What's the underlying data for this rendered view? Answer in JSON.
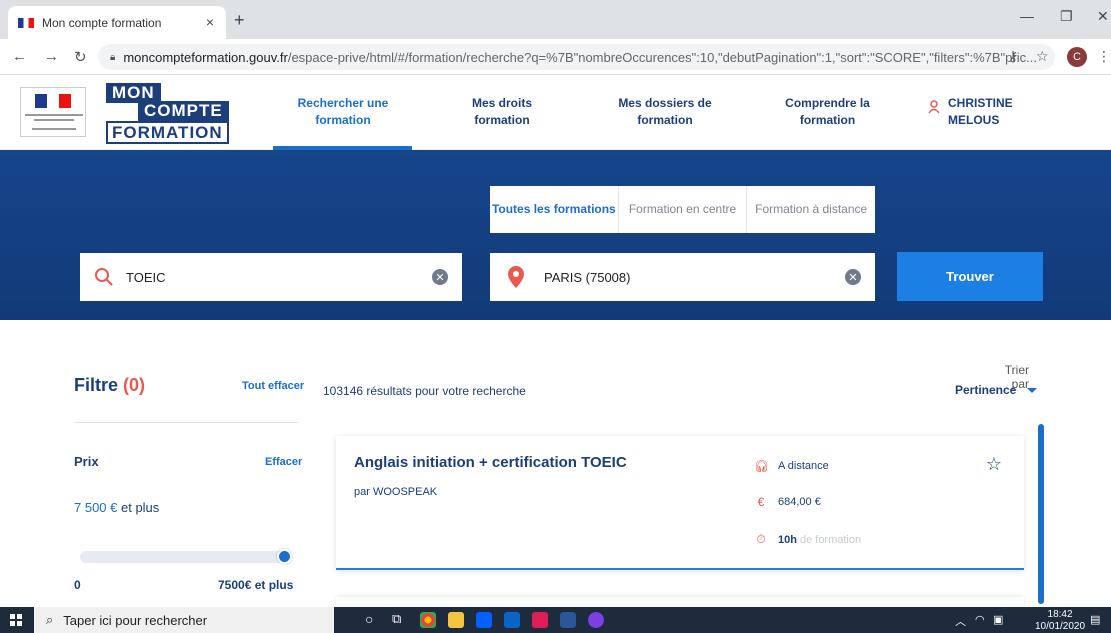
{
  "browser": {
    "tab_title": "Mon compte formation",
    "tab_close": "×",
    "new_tab": "+",
    "url_host": "moncompteformation.gouv.fr",
    "url_rest": "/espace-prive/html/#/formation/recherche?q=%7B\"nombreOccurences\":10,\"debutPagination\":1,\"sort\":\"SCORE\",\"filters\":%7B\"pric...",
    "profile_initial": "C"
  },
  "header": {
    "logo": {
      "line1": "MON",
      "line2": "COMPTE",
      "line3": "FORMATION"
    },
    "menu": [
      {
        "label": "Rechercher une formation"
      },
      {
        "label": "Mes droits formation"
      },
      {
        "label": "Mes dossiers de formation"
      },
      {
        "label": "Comprendre la formation"
      }
    ],
    "user": {
      "first": "CHRISTINE",
      "last": "MELOUS"
    }
  },
  "search": {
    "tabs": [
      {
        "label": "Toutes les formations"
      },
      {
        "label": "Formation en centre"
      },
      {
        "label": "Formation à distance"
      }
    ],
    "query": "TOEIC",
    "location": "PARIS (75008)",
    "button": "Trouver"
  },
  "filters": {
    "title": "Filtre",
    "count": "(0)",
    "clear_all": "Tout effacer",
    "price": {
      "label": "Prix",
      "clear": "Effacer",
      "value_amount": "7 500 €",
      "value_suffix": " et plus",
      "min": "0",
      "max": "7500€ et plus",
      "slider_fraction": 1.0
    }
  },
  "results": {
    "count_text": "103146 résultats pour votre recherche",
    "sort_label": "Trier par",
    "sort_value": "Pertinence",
    "items": [
      {
        "title": "Anglais initiation + certification TOEIC",
        "provider": "par WOOSPEAK",
        "mode": "A distance",
        "price": "684,00 €",
        "duration": "10h",
        "duration_suffix": "de formation"
      }
    ]
  },
  "taskbar": {
    "search_placeholder": "Taper ici pour rechercher",
    "time": "18:42",
    "date": "10/01/2020"
  },
  "colors": {
    "brand_blue": "#1c3f7a",
    "accent_blue": "#1b6fc8",
    "hero_blue": "#16458a",
    "accent_red": "#e85a4f"
  }
}
